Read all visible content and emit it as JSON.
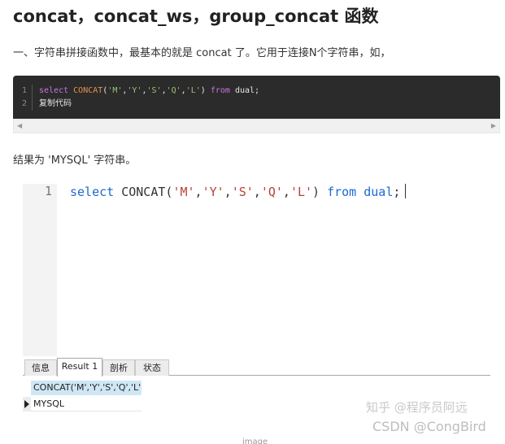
{
  "heading": "concat，concat_ws，group_concat 函数",
  "intro": "一、字符串拼接函数中，最基本的就是 concat 了。它用于连接N个字符串，如，",
  "code_block": {
    "line_numbers": [
      "1",
      "2"
    ],
    "select_kw": "select",
    "fn": "CONCAT",
    "open": "(",
    "args": [
      "'M'",
      "'Y'",
      "'S'",
      "'Q'",
      "'L'"
    ],
    "comma": ",",
    "close": ")",
    "from_kw": "from",
    "table": "dual;",
    "copy_label": "复制代码"
  },
  "result_text": "结果为 'MYSQL' 字符串。",
  "editor": {
    "line_number": "1",
    "select_kw": "select",
    "fn": "CONCAT",
    "open": "(",
    "args": [
      "'M'",
      "'Y'",
      "'S'",
      "'Q'",
      "'L'"
    ],
    "comma": ",",
    "close": ")",
    "from_kw": "from",
    "table": "dual",
    "semicolon": ";"
  },
  "tabs": [
    "信息",
    "Result 1",
    "剖析",
    "状态"
  ],
  "active_tab": "Result 1",
  "result_grid": {
    "column": "CONCAT('M','Y','S','Q','L')",
    "rows": [
      "MYSQL"
    ]
  },
  "watermarks": [
    "知乎 @程序员阿远",
    "CSDN @CongBird"
  ],
  "caption": "image",
  "colors": {
    "code_bg": "#2b2b2b",
    "sql_keyword": "#1c69d4",
    "sql_string": "#b44336",
    "grid_header": "#cfe7f4"
  }
}
